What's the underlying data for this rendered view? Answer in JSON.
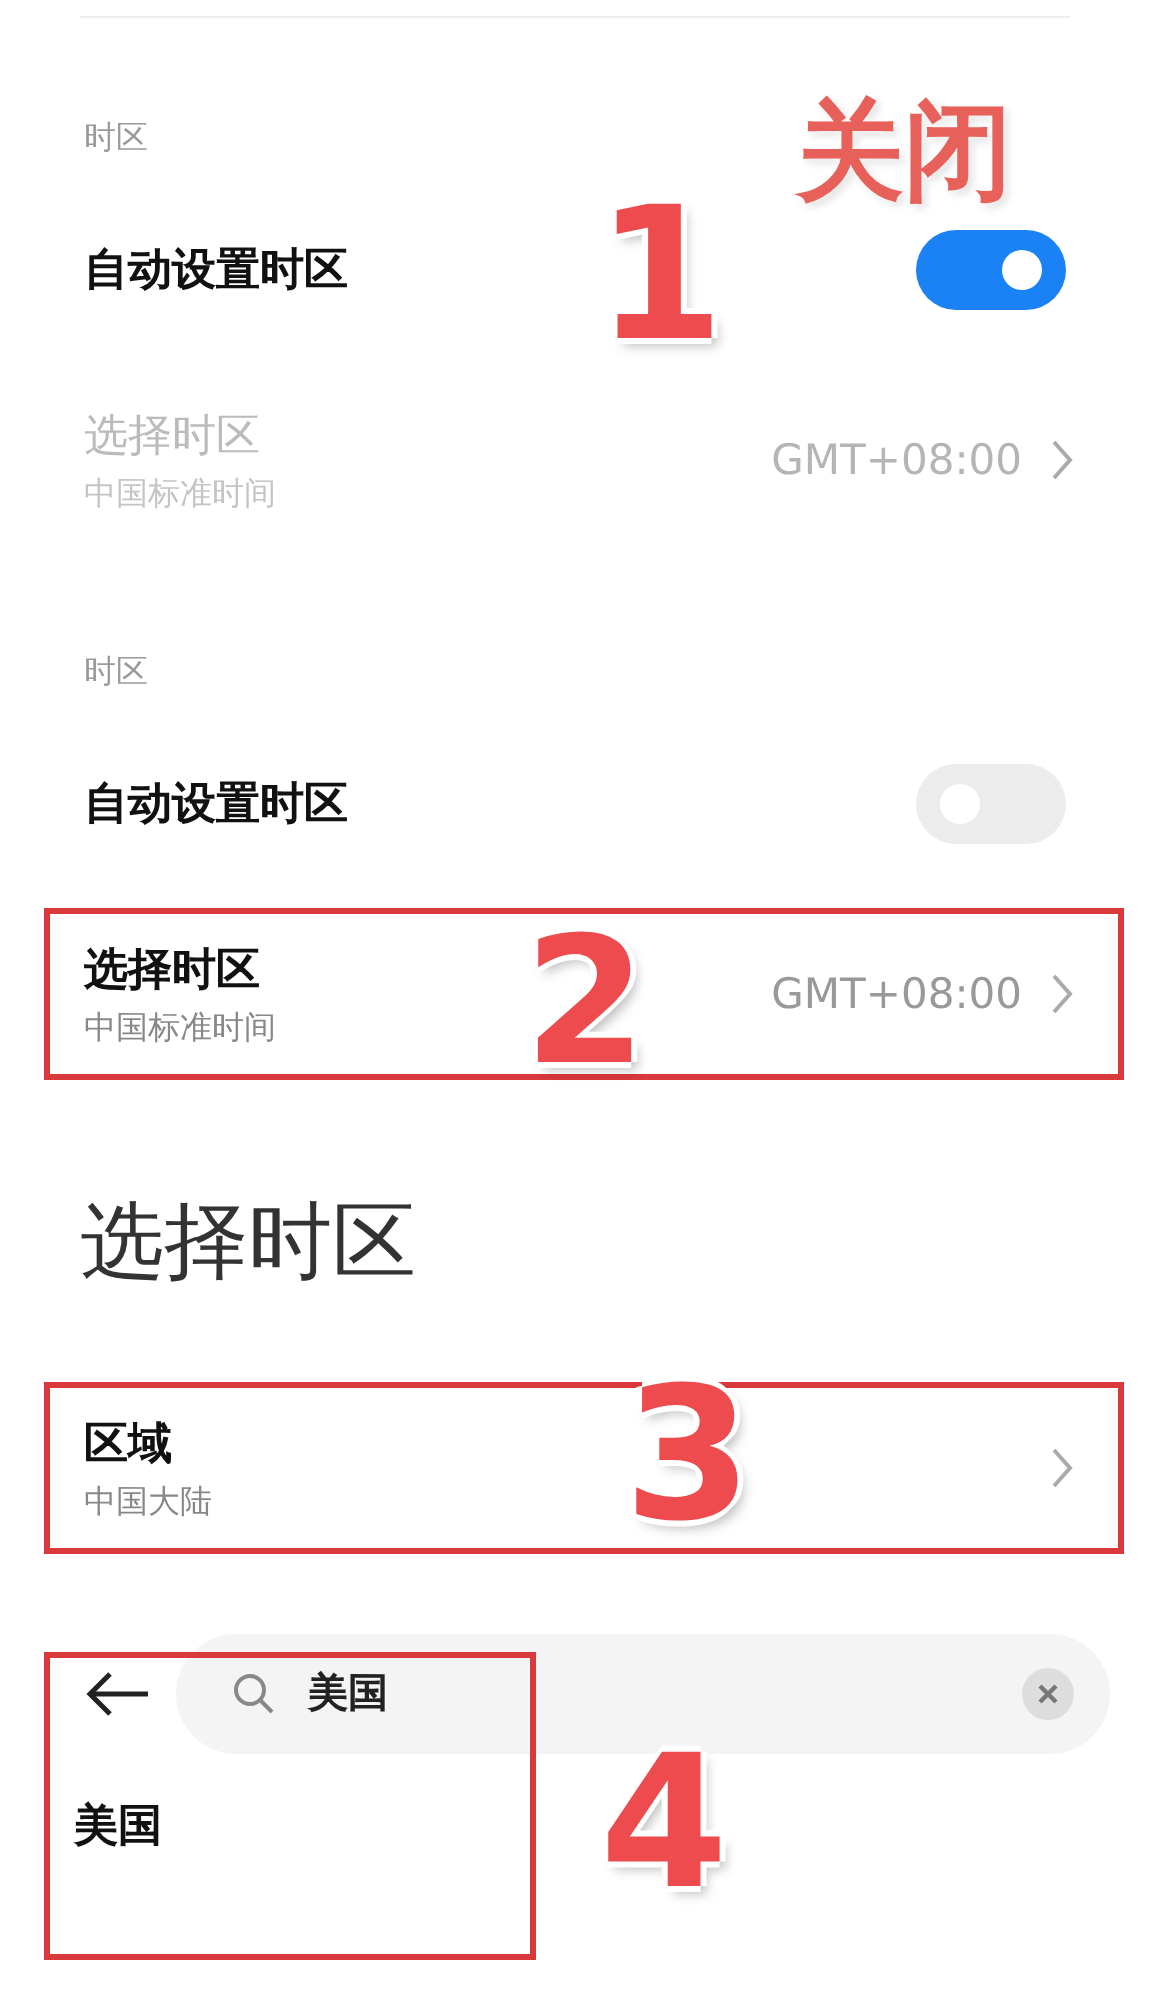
{
  "sections": [
    {
      "header": "时区",
      "rows": [
        {
          "kind": "switch",
          "title": "自动设置时区",
          "on": true
        },
        {
          "kind": "link",
          "title": "选择时区",
          "subtitle": "中国标准时间",
          "value": "GMT+08:00",
          "disabled": true,
          "highlighted": false
        }
      ]
    },
    {
      "header": "时区",
      "rows": [
        {
          "kind": "switch",
          "title": "自动设置时区",
          "on": false
        },
        {
          "kind": "link",
          "title": "选择时区",
          "subtitle": "中国标准时间",
          "value": "GMT+08:00",
          "disabled": false,
          "highlighted": true,
          "annotation": "2"
        }
      ]
    }
  ],
  "page_title": "选择时区",
  "region_row": {
    "title": "区域",
    "subtitle": "中国大陆",
    "highlighted": true,
    "annotation": "3"
  },
  "search": {
    "value": "美国"
  },
  "results": [
    "美国"
  ],
  "annotations": [
    {
      "kind": "label",
      "text": "关闭"
    },
    {
      "kind": "number",
      "text": "1"
    },
    {
      "kind": "number",
      "text": "4"
    }
  ]
}
